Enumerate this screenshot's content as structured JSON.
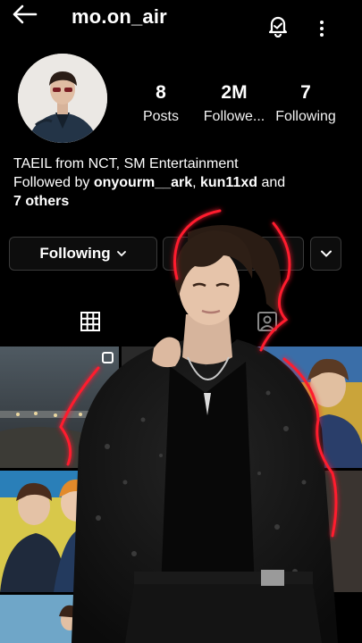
{
  "header": {
    "username": "mo.on_air",
    "icons": [
      "back-arrow-icon",
      "bell-icon",
      "more-vertical-icon"
    ]
  },
  "profile": {
    "stats": [
      {
        "value": "8",
        "label": "Posts"
      },
      {
        "value": "2M",
        "label": "Followe..."
      },
      {
        "value": "7",
        "label": "Following"
      }
    ],
    "bio": {
      "line1": "TAEIL from NCT, SM Entertainment",
      "followed_prefix": "Followed by ",
      "follower1": "onyourm__ark",
      "separator": ", ",
      "follower2": "kun11xd",
      "and": " and",
      "others": "7 others"
    }
  },
  "actions": {
    "following_label": "Following",
    "chevron": "chevron-down-icon"
  },
  "tabs": [
    "grid-icon",
    "tagged-icon"
  ],
  "colors": {
    "background": "#000000",
    "border": "#3a3a3a",
    "neon": "#ff1a2e"
  }
}
